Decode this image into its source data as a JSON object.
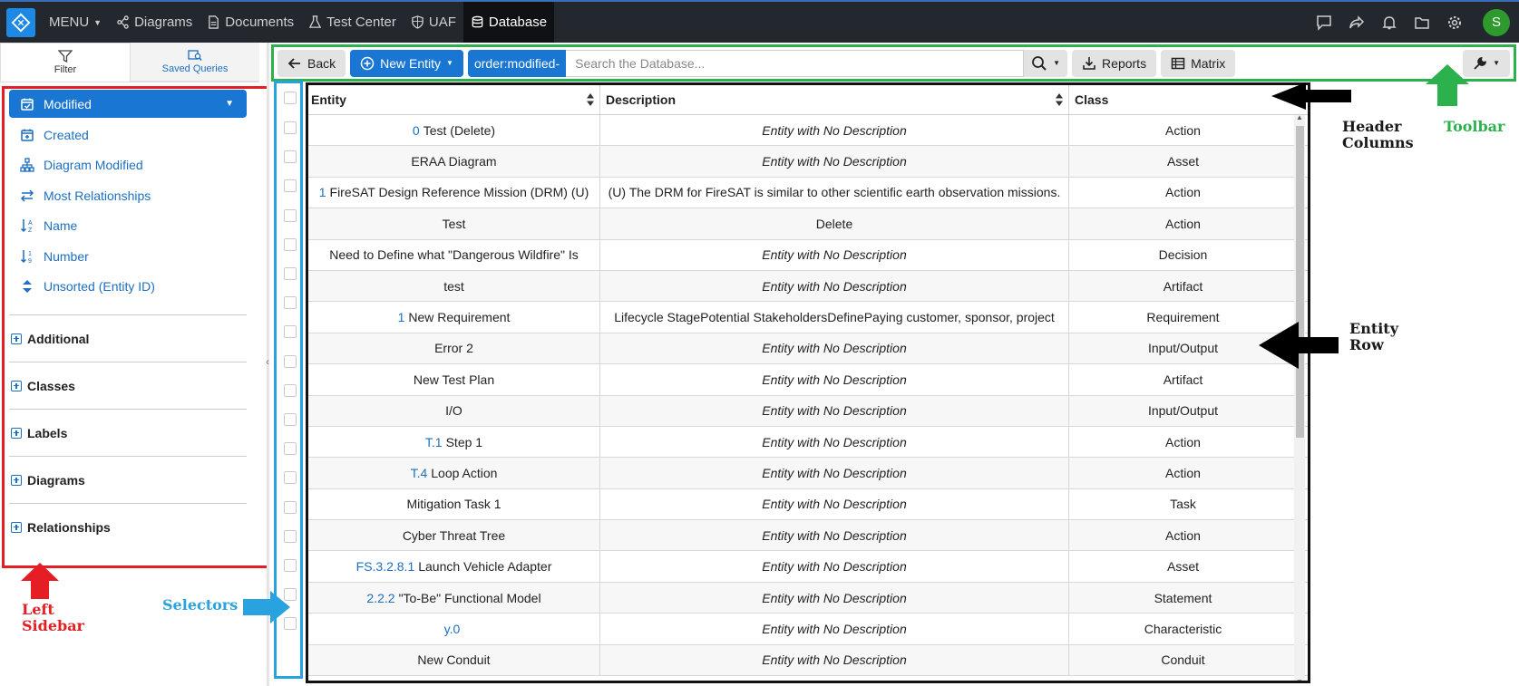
{
  "nav": {
    "menu_label": "MENU",
    "items": [
      {
        "label": "Diagrams",
        "icon": "diagrams-icon"
      },
      {
        "label": "Documents",
        "icon": "document-icon"
      },
      {
        "label": "Test Center",
        "icon": "flask-icon"
      },
      {
        "label": "UAF",
        "icon": "shield-icon"
      },
      {
        "label": "Database",
        "icon": "database-icon",
        "active": true
      }
    ],
    "right_icons": [
      "chat-icon",
      "share-icon",
      "bell-icon",
      "folder-icon",
      "gear-icon"
    ],
    "avatar_initial": "S"
  },
  "sidebar": {
    "tabs": [
      {
        "label": "Filter",
        "icon": "filter-icon"
      },
      {
        "label": "Saved Queries",
        "icon": "saved-queries-icon"
      }
    ],
    "sort_options": [
      {
        "label": "Modified",
        "icon": "calendar-check-icon",
        "selected": true
      },
      {
        "label": "Created",
        "icon": "calendar-plus-icon"
      },
      {
        "label": "Diagram Modified",
        "icon": "hierarchy-icon"
      },
      {
        "label": "Most Relationships",
        "icon": "exchange-icon"
      },
      {
        "label": "Name",
        "icon": "sort-alpha-icon"
      },
      {
        "label": "Number",
        "icon": "sort-numeric-icon"
      },
      {
        "label": "Unsorted (Entity ID)",
        "icon": "sort-icon"
      }
    ],
    "sections": [
      "Additional",
      "Classes",
      "Labels",
      "Diagrams",
      "Relationships"
    ]
  },
  "toolbar": {
    "back_label": "Back",
    "new_entity_label": "New Entity",
    "order_chip": "order:modified-",
    "search_placeholder": "Search the Database...",
    "reports_label": "Reports",
    "matrix_label": "Matrix"
  },
  "table": {
    "headers": [
      "Entity",
      "Description",
      "Class"
    ],
    "rows": [
      {
        "num": "0",
        "name": "Test (Delete)",
        "desc": "Entity with No Description",
        "desc_italic": true,
        "cls": "Action"
      },
      {
        "num": "",
        "name": "ERAA Diagram",
        "desc": "Entity with No Description",
        "desc_italic": true,
        "cls": "Asset"
      },
      {
        "num": "1",
        "name": "FireSAT Design Reference Mission (DRM) (U)",
        "desc": "(U) The DRM for FireSAT is similar to other scientific earth observation missions.",
        "desc_italic": false,
        "cls": "Action"
      },
      {
        "num": "",
        "name": "Test",
        "desc": "Delete",
        "desc_italic": false,
        "cls": "Action"
      },
      {
        "num": "",
        "name": "Need to Define what \"Dangerous Wildfire\" Is",
        "desc": "Entity with No Description",
        "desc_italic": true,
        "cls": "Decision"
      },
      {
        "num": "",
        "name": "test",
        "desc": "Entity with No Description",
        "desc_italic": true,
        "cls": "Artifact"
      },
      {
        "num": "1",
        "name": "New Requirement",
        "desc": "Lifecycle StagePotential StakeholdersDefinePaying customer, sponsor, project",
        "desc_italic": false,
        "cls": "Requirement"
      },
      {
        "num": "",
        "name": "Error 2",
        "desc": "Entity with No Description",
        "desc_italic": true,
        "cls": "Input/Output"
      },
      {
        "num": "",
        "name": "New Test Plan",
        "desc": "Entity with No Description",
        "desc_italic": true,
        "cls": "Artifact"
      },
      {
        "num": "",
        "name": "I/O",
        "desc": "Entity with No Description",
        "desc_italic": true,
        "cls": "Input/Output"
      },
      {
        "num": "T.1",
        "name": "Step 1",
        "desc": "Entity with No Description",
        "desc_italic": true,
        "cls": "Action"
      },
      {
        "num": "T.4",
        "name": "Loop Action",
        "desc": "Entity with No Description",
        "desc_italic": true,
        "cls": "Action"
      },
      {
        "num": "",
        "name": "Mitigation Task 1",
        "desc": "Entity with No Description",
        "desc_italic": true,
        "cls": "Task"
      },
      {
        "num": "",
        "name": "Cyber Threat Tree",
        "desc": "Entity with No Description",
        "desc_italic": true,
        "cls": "Action"
      },
      {
        "num": "FS.3.2.8.1",
        "name": "Launch Vehicle Adapter",
        "desc": "Entity with No Description",
        "desc_italic": true,
        "cls": "Asset"
      },
      {
        "num": "2.2.2",
        "name": "\"To-Be\" Functional Model",
        "desc": "Entity with No Description",
        "desc_italic": true,
        "cls": "Statement"
      },
      {
        "num": "y.0",
        "name": "",
        "desc": "Entity with No Description",
        "desc_italic": true,
        "cls": "Characteristic"
      },
      {
        "num": "",
        "name": "New Conduit",
        "desc": "Entity with No Description",
        "desc_italic": true,
        "cls": "Conduit"
      }
    ]
  },
  "annotations": {
    "header_columns": "Header\nColumns",
    "toolbar": "Toolbar",
    "entity_row": "Entity\nRow",
    "left_sidebar": "Left\nSidebar",
    "selectors": "Selectors"
  },
  "colors": {
    "nav_bg": "#23272e",
    "accent": "#1976d2",
    "sidebar_annotation": "#e41e24",
    "toolbar_annotation": "#2bb24c",
    "selectors_annotation": "#29a3df"
  }
}
